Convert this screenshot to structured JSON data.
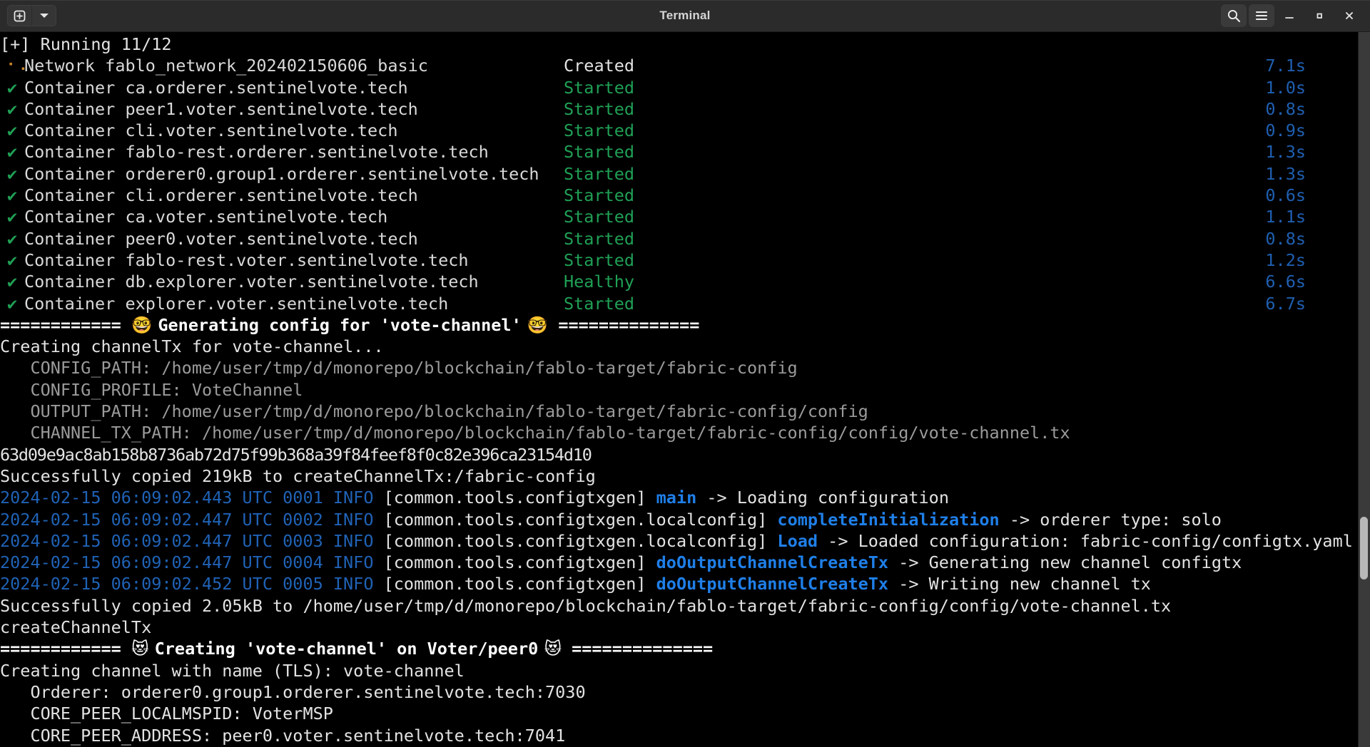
{
  "window": {
    "title": "Terminal",
    "new_tab_icon": "plus-in-box-icon",
    "new_tab_menu_icon": "chevron-down-icon",
    "search_icon": "search-icon",
    "menu_icon": "hamburger-menu-icon",
    "minimize_icon": "minimize-icon",
    "maximize_icon": "maximize-icon",
    "close_icon": "close-icon"
  },
  "terminal": {
    "header": "[+] Running 11/12",
    "compose_rows": [
      {
        "mark": "⠂⠄",
        "mark_type": "spinner",
        "name": "Network fablo_network_202402150606_basic",
        "status": "Created",
        "status_color": "white",
        "time": "7.1s"
      },
      {
        "mark": "✔",
        "mark_type": "check",
        "name": "Container ca.orderer.sentinelvote.tech",
        "status": "Started",
        "status_color": "green",
        "time": "1.0s"
      },
      {
        "mark": "✔",
        "mark_type": "check",
        "name": "Container peer1.voter.sentinelvote.tech",
        "status": "Started",
        "status_color": "green",
        "time": "0.8s"
      },
      {
        "mark": "✔",
        "mark_type": "check",
        "name": "Container cli.voter.sentinelvote.tech",
        "status": "Started",
        "status_color": "green",
        "time": "0.9s"
      },
      {
        "mark": "✔",
        "mark_type": "check",
        "name": "Container fablo-rest.orderer.sentinelvote.tech",
        "status": "Started",
        "status_color": "green",
        "time": "1.3s"
      },
      {
        "mark": "✔",
        "mark_type": "check",
        "name": "Container orderer0.group1.orderer.sentinelvote.tech",
        "status": "Started",
        "status_color": "green",
        "time": "1.3s"
      },
      {
        "mark": "✔",
        "mark_type": "check",
        "name": "Container cli.orderer.sentinelvote.tech",
        "status": "Started",
        "status_color": "green",
        "time": "0.6s"
      },
      {
        "mark": "✔",
        "mark_type": "check",
        "name": "Container ca.voter.sentinelvote.tech",
        "status": "Started",
        "status_color": "green",
        "time": "1.1s"
      },
      {
        "mark": "✔",
        "mark_type": "check",
        "name": "Container peer0.voter.sentinelvote.tech",
        "status": "Started",
        "status_color": "green",
        "time": "0.8s"
      },
      {
        "mark": "✔",
        "mark_type": "check",
        "name": "Container fablo-rest.voter.sentinelvote.tech",
        "status": "Started",
        "status_color": "green",
        "time": "1.2s"
      },
      {
        "mark": "✔",
        "mark_type": "check",
        "name": "Container db.explorer.voter.sentinelvote.tech",
        "status": "Healthy",
        "status_color": "green",
        "time": "6.6s"
      },
      {
        "mark": "✔",
        "mark_type": "check",
        "name": "Container explorer.voter.sentinelvote.tech",
        "status": "Started",
        "status_color": "green",
        "time": "6.7s"
      }
    ],
    "banner_generating": {
      "left_rule": "============",
      "emoji": "🤓",
      "text": "Generating config for 'vote-channel'",
      "right_rule": "=============="
    },
    "creating_channeltx": "Creating channelTx for vote-channel...",
    "config_vars": [
      {
        "key": "CONFIG_PATH:",
        "value": "/home/user/tmp/d/monorepo/blockchain/fablo-target/fabric-config"
      },
      {
        "key": "CONFIG_PROFILE:",
        "value": "VoteChannel"
      },
      {
        "key": "OUTPUT_PATH:",
        "value": "/home/user/tmp/d/monorepo/blockchain/fablo-target/fabric-config/config"
      },
      {
        "key": "CHANNEL_TX_PATH:",
        "value": "/home/user/tmp/d/monorepo/blockchain/fablo-target/fabric-config/config/vote-channel.tx"
      }
    ],
    "container_hash": "63d09e9ac8ab158b8736ab72d75f99b368a39f84feef8f0c82e396ca23154d10",
    "copied_1": "Successfully copied 219kB to createChannelTx:/fabric-config",
    "log_lines": [
      {
        "ts": "2024-02-15 06:09:02.443 UTC 0001 INFO",
        "module": "[common.tools.configtxgen]",
        "func": "main",
        "rest": "-> Loading configuration"
      },
      {
        "ts": "2024-02-15 06:09:02.447 UTC 0002 INFO",
        "module": "[common.tools.configtxgen.localconfig]",
        "func": "completeInitialization",
        "rest": "-> orderer type: solo"
      },
      {
        "ts": "2024-02-15 06:09:02.447 UTC 0003 INFO",
        "module": "[common.tools.configtxgen.localconfig]",
        "func": "Load",
        "rest": "-> Loaded configuration: fabric-config/configtx.yaml"
      },
      {
        "ts": "2024-02-15 06:09:02.447 UTC 0004 INFO",
        "module": "[common.tools.configtxgen]",
        "func": "doOutputChannelCreateTx",
        "rest": "-> Generating new channel configtx"
      },
      {
        "ts": "2024-02-15 06:09:02.452 UTC 0005 INFO",
        "module": "[common.tools.configtxgen]",
        "func": "doOutputChannelCreateTx",
        "rest": "-> Writing new channel tx"
      }
    ],
    "copied_2": "Successfully copied 2.05kB to /home/user/tmp/d/monorepo/blockchain/fablo-target/fabric-config/config/vote-channel.tx",
    "create_channel_tx": "createChannelTx",
    "banner_creating": {
      "left_rule": "============",
      "emoji": "😻",
      "text": "Creating 'vote-channel' on Voter/peer0",
      "right_rule": "=============="
    },
    "creating_channel_tls": "Creating channel with name (TLS): vote-channel",
    "channel_vars": [
      {
        "key": "Orderer:",
        "value": "orderer0.group1.orderer.sentinelvote.tech:7030"
      },
      {
        "key": "CORE_PEER_LOCALMSPID:",
        "value": "VoterMSP"
      },
      {
        "key": "CORE_PEER_ADDRESS:",
        "value": "peer0.voter.sentinelvote.tech:7041"
      }
    ]
  },
  "colors": {
    "green": "#20a055",
    "blue": "#2062b5",
    "bright_blue": "#1f7fe8",
    "orange": "#d08a2a",
    "background": "#000000",
    "foreground": "#d9d9d9",
    "titlebar": "#2b2b2b"
  }
}
